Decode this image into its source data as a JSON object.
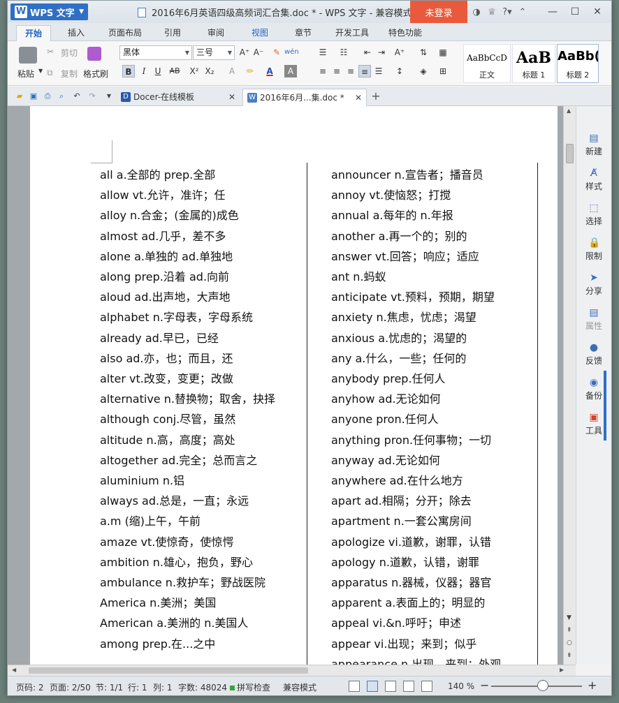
{
  "titlebar": {
    "app_name": "WPS 文字",
    "doc_title": "2016年6月英语四级高频词汇合集.doc * - WPS 文字 - 兼容模式",
    "login_label": "未登录"
  },
  "menu_tabs": [
    {
      "label": "开始"
    },
    {
      "label": "插入"
    },
    {
      "label": "页面布局"
    },
    {
      "label": "引用"
    },
    {
      "label": "审阅"
    },
    {
      "label": "视图"
    },
    {
      "label": "章节"
    },
    {
      "label": "开发工具"
    },
    {
      "label": "特色功能"
    }
  ],
  "ribbon": {
    "paste": "粘贴",
    "cut": "剪切",
    "copy": "复制",
    "format_painter": "格式刷",
    "font_name": "黑体",
    "font_size": "三号",
    "style_normal_sample": "AaBbCcD",
    "style_normal": "正文",
    "style_h1_sample": "AaB",
    "style_h1": "标题 1",
    "style_h2_sample": "AaBb(",
    "style_h2": "标题 2"
  },
  "doc_tabs": [
    {
      "label": "Docer-在线模板"
    },
    {
      "label": "2016年6月...集.doc *"
    }
  ],
  "document": {
    "left_column": [
      "all a.全部的 prep.全部",
      "allow vt.允许，准许；任",
      "alloy n.合金；(金属的)成色",
      "almost ad.几乎，差不多",
      "alone a.单独的 ad.单独地",
      "along prep.沿着 ad.向前",
      "aloud ad.出声地，大声地",
      "alphabet n.字母表，字母系统",
      "already ad.早已，已经",
      "also ad.亦，也；而且，还",
      "alter vt.改变，变更；改做",
      "alternative n.替换物；取舍，抉择",
      "although conj.尽管，虽然",
      "altitude n.高，高度；高处",
      "altogether ad.完全；总而言之",
      "aluminium n.铝",
      "always ad.总是，一直；永远",
      "a.m (缩)上午，午前",
      "amaze vt.使惊奇，使惊愕",
      "ambition n.雄心，抱负，野心",
      "ambulance n.救护车；野战医院",
      "America n.美洲；美国",
      "American a.美洲的 n.美国人",
      "among prep.在...之中"
    ],
    "right_column": [
      "announcer n.宣告者；播音员",
      "annoy vt.使恼怒；打搅",
      "annual a.每年的 n.年报",
      "another a.再一个的；别的",
      "answer vt.回答；响应；适应",
      "ant n.蚂蚁",
      "anticipate vt.预料，预期，期望",
      "anxiety n.焦虑，忧虑；渴望",
      "anxious a.忧虑的；渴望的",
      "any a.什么，一些；任何的",
      "anybody prep.任何人",
      "anyhow ad.无论如何",
      "anyone pron.任何人",
      "anything pron.任何事物；一切",
      "anyway ad.无论如何",
      "anywhere ad.在什么地方",
      "apart ad.相隔；分开；除去",
      "apartment n.一套公寓房间",
      "apologize vi.道歉，谢罪，认错",
      "apology n.道歉，认错，谢罪",
      "apparatus n.器械，仪器；器官",
      "apparent a.表面上的；明显的",
      "appeal vi.&n.呼吁；申述",
      "appear vi.出现；来到；似乎",
      "appearance n.出现，来到；外观"
    ]
  },
  "sidebar": [
    {
      "label": "新建",
      "icon": "new-doc-icon"
    },
    {
      "label": "样式",
      "icon": "style-icon"
    },
    {
      "label": "选择",
      "icon": "select-icon"
    },
    {
      "label": "限制",
      "icon": "restrict-icon"
    },
    {
      "label": "分享",
      "icon": "share-icon"
    },
    {
      "label": "属性",
      "icon": "properties-icon"
    },
    {
      "label": "反馈",
      "icon": "feedback-icon"
    },
    {
      "label": "备份",
      "icon": "backup-icon"
    },
    {
      "label": "工具",
      "icon": "toolbox-icon"
    }
  ],
  "statusbar": {
    "page_code": "页码: 2",
    "page": "页面: 2/50",
    "section": "节: 1/1",
    "row": "行: 1",
    "col": "列: 1",
    "word_count": "字数: 48024",
    "spell_check": "拼写检查",
    "compat_mode": "兼容模式",
    "zoom": "140 %"
  },
  "colors": {
    "accent": "#2f6fc4",
    "login": "#e95a3c"
  }
}
